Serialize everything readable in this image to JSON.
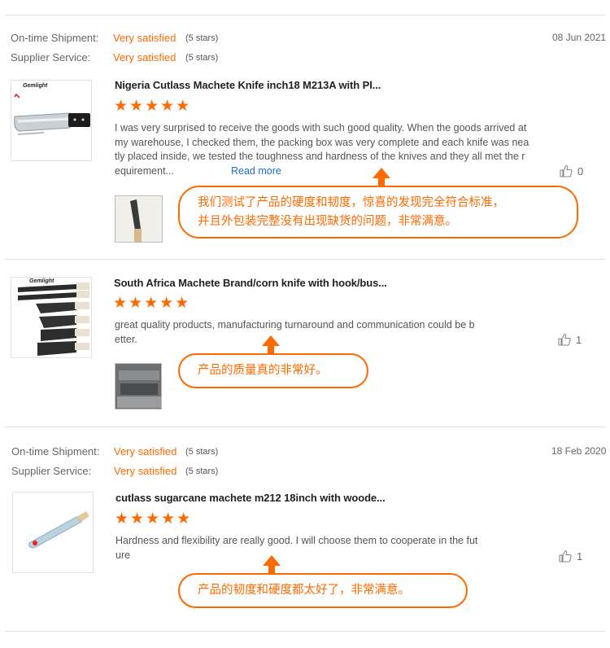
{
  "labels": {
    "shipment": "On-time Shipment:",
    "supplier": "Supplier Service:"
  },
  "colors": {
    "accent": "#ff6a00",
    "link": "#1a6fd1"
  },
  "reviews": [
    {
      "date": "08 Jun 2021",
      "shipment_rating": "Very satisfied",
      "shipment_stars": "(5 stars)",
      "supplier_rating": "Very satisfied",
      "supplier_stars": "(5 stars)",
      "product_title": "Nigeria Cutlass Machete Knife inch18 M213A with Pl...",
      "rating": "★★★★★",
      "text_lines": [
        "I was very surprised to receive the goods with such good quality. When the goods arrived at",
        "my warehouse, I checked them, the packing box was very complete and each knife was nea",
        "tly placed inside, we tested the toughness and hardness of the knives and they all met the r",
        "equirement..."
      ],
      "read_more": "Read more",
      "likes": "0",
      "thumb_brand": "Gemlight",
      "callout_lines": [
        "我们测试了产品的硬度和韧度，惊喜的发现完全符合标准，",
        "并且外包装完整没有出现缺货的问题，非常满意。"
      ]
    },
    {
      "product_title": "South Africa Machete Brand/corn knife with hook/bus...",
      "rating": "★★★★★",
      "text_lines": [
        "great quality products, manufacturing turnaround and communication could be b",
        "etter."
      ],
      "likes": "1",
      "thumb_brand": "Gemlight",
      "callout_lines": [
        "产品的质量真的非常好。"
      ]
    },
    {
      "date": "18 Feb 2020",
      "shipment_rating": "Very satisfied",
      "shipment_stars": "(5 stars)",
      "supplier_rating": "Very satisfied",
      "supplier_stars": "(5 stars)",
      "product_title": "cutlass sugarcane machete m212 18inch with woode...",
      "rating": "★★★★★",
      "text_lines": [
        "Hardness and flexibility are really good. I will choose them to cooperate in the fut",
        "ure"
      ],
      "likes": "1",
      "callout_lines": [
        "产品的韧度和硬度都太好了，非常满意。"
      ]
    }
  ]
}
